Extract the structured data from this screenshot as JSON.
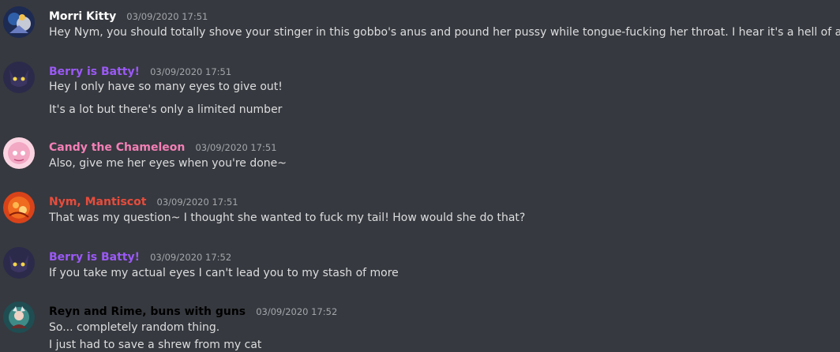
{
  "messages": [
    {
      "author": "Morri Kitty",
      "author_color": "#ffffff",
      "timestamp": "03/09/2020 17:51",
      "lines": [
        "Hey Nym, you should totally shove your stinger in this gobbo's anus and pound her pussy while tongue-fucking her throat. I hear it's a hell of a time."
      ],
      "avatar_icon": "morri-kitty-avatar"
    },
    {
      "author": "Berry is Batty!",
      "author_color": "#9b59f6",
      "timestamp": "03/09/2020 17:51",
      "lines": [
        "Hey I only have so many eyes to give out!",
        "It's a lot but there's only a limited number"
      ],
      "avatar_icon": "berry-avatar"
    },
    {
      "author": "Candy the Chameleon",
      "author_color": "#f47fb6",
      "timestamp": "03/09/2020 17:51",
      "lines": [
        "Also, give me her eyes when you're done~"
      ],
      "avatar_icon": "candy-avatar"
    },
    {
      "author": "Nym, Mantiscot",
      "author_color": "#e74c3c",
      "timestamp": "03/09/2020 17:51",
      "lines": [
        "That was my question~ I thought she wanted to fuck my tail! How would she do that?"
      ],
      "avatar_icon": "nym-avatar"
    },
    {
      "author": "Berry is Batty!",
      "author_color": "#9b59f6",
      "timestamp": "03/09/2020 17:52",
      "lines": [
        "If you take my actual eyes I can't lead you to my stash of more"
      ],
      "avatar_icon": "berry-avatar"
    },
    {
      "author": "Reyn and Rime, buns with guns",
      "author_color": "#000000",
      "timestamp": "03/09/2020 17:52",
      "lines": [
        "So... completely random thing.",
        "I just had to save a shrew from my cat"
      ],
      "avatar_icon": "reyn-avatar"
    }
  ]
}
